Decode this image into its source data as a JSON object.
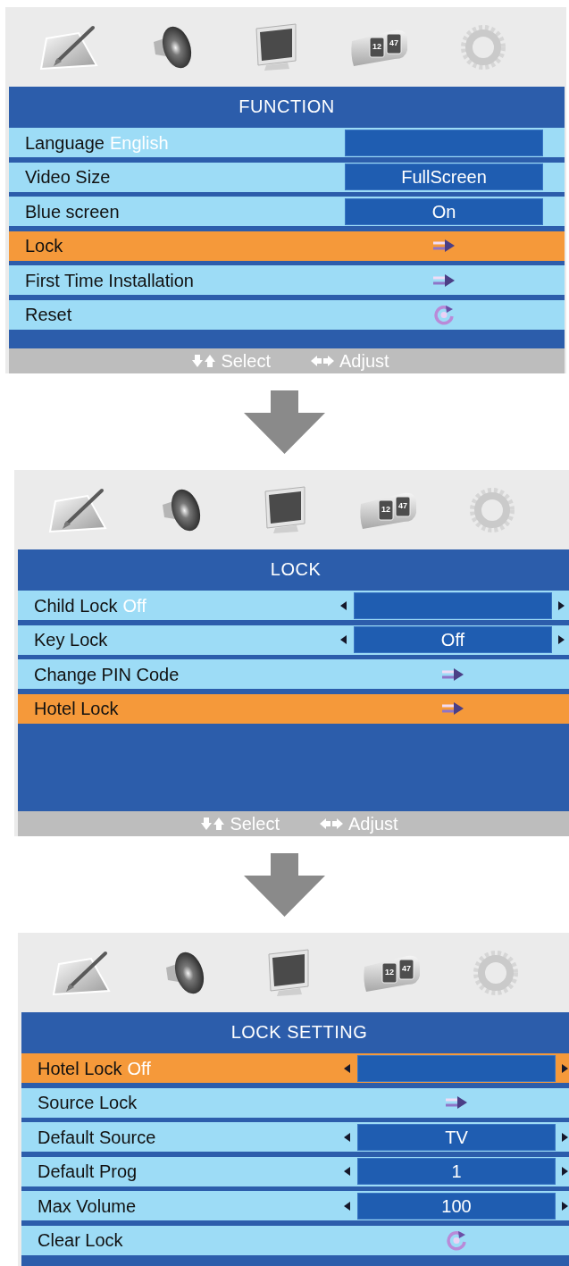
{
  "panels": [
    {
      "time_tab": {
        "digits": [
          "12",
          "47"
        ]
      },
      "title": "FUNCTION",
      "rows": [
        {
          "kind": "box",
          "label": "Language",
          "inline_value": "English",
          "selected": false
        },
        {
          "kind": "box",
          "label": "Video Size",
          "value": "FullScreen",
          "selected": false
        },
        {
          "kind": "box",
          "label": "Blue screen",
          "value": "On",
          "selected": false
        },
        {
          "kind": "submenu",
          "label": "Lock",
          "selected": true
        },
        {
          "kind": "submenu",
          "label": "First Time Installation",
          "selected": false
        },
        {
          "kind": "reset",
          "label": "Reset",
          "selected": false
        }
      ],
      "footer": [
        {
          "kind": "updown",
          "label": "Select"
        },
        {
          "kind": "leftright",
          "label": "Adjust"
        }
      ]
    },
    {
      "time_tab": {
        "digits": [
          "12",
          "47"
        ]
      },
      "title": "LOCK",
      "rows": [
        {
          "kind": "spin",
          "label": "Child Lock",
          "inline_value": "Off",
          "selected": false
        },
        {
          "kind": "spin",
          "label": "Key Lock",
          "value": "Off",
          "selected": false
        },
        {
          "kind": "submenu",
          "label": "Change PIN Code",
          "selected": false
        },
        {
          "kind": "submenu",
          "label": "Hotel Lock",
          "selected": true
        }
      ],
      "footer": [
        {
          "kind": "updown",
          "label": "Select"
        },
        {
          "kind": "leftright",
          "label": "Adjust"
        }
      ]
    },
    {
      "time_tab": {
        "digits": [
          "12",
          "47"
        ]
      },
      "title": "LOCK SETTING",
      "rows": [
        {
          "kind": "spin",
          "label": "Hotel Lock",
          "inline_value": "Off",
          "selected": true
        },
        {
          "kind": "submenu",
          "label": "Source Lock",
          "selected": false
        },
        {
          "kind": "spin",
          "label": "Default Source",
          "value": "TV",
          "selected": false
        },
        {
          "kind": "spin",
          "label": "Default Prog",
          "value": "1",
          "selected": false
        },
        {
          "kind": "spin",
          "label": "Max Volume",
          "value": "100",
          "selected": false
        },
        {
          "kind": "reset",
          "label": "Clear Lock",
          "selected": false
        }
      ]
    }
  ]
}
